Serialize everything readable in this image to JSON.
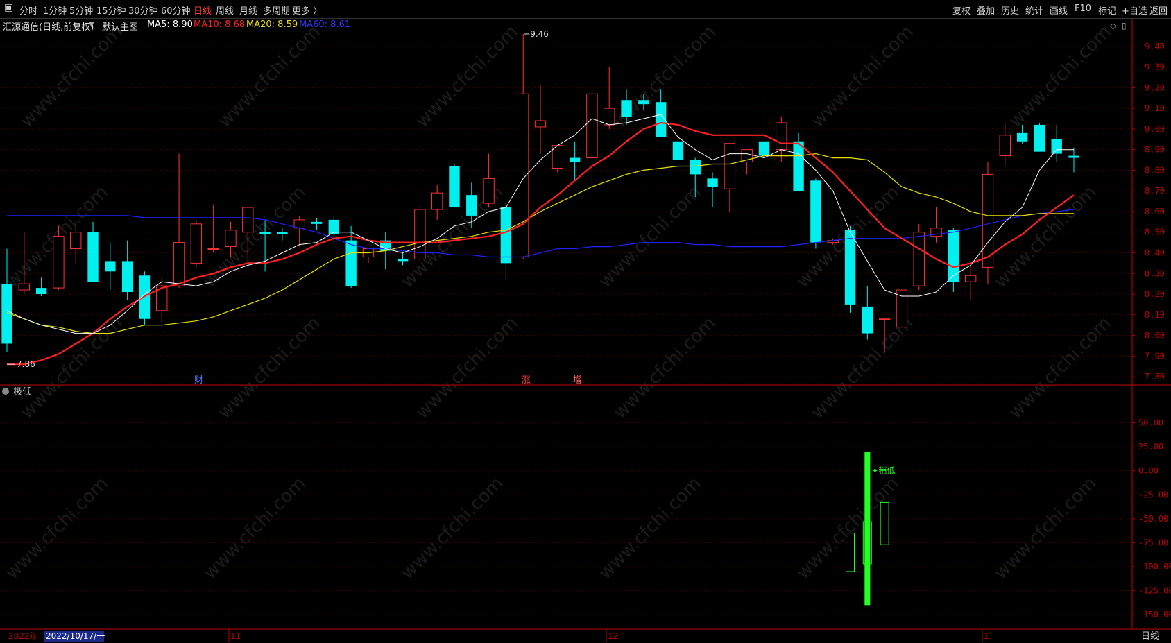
{
  "toolbar": {
    "left_items": [
      "分时",
      "1分钟",
      "5分钟",
      "15分钟",
      "30分钟",
      "60分钟",
      "日线",
      "周线",
      "月线",
      "多周期",
      "更多 〉"
    ],
    "active": "日线",
    "right_items": [
      "复权",
      "叠加",
      "历史",
      "统计",
      "画线",
      "F10",
      "标记",
      "+自选",
      "返回"
    ]
  },
  "info": {
    "title": "汇源通信(日线,前复权)",
    "main_label": "默认主图",
    "ma5": "MA5: 8.90",
    "ma10": "MA10: 8.68",
    "ma20": "MA20: 8.59",
    "ma60": "MA60: 8.61"
  },
  "colors": {
    "up": "#ff3333",
    "down": "#00f0f0",
    "ma5": "#ffffff",
    "ma10": "#ff2020",
    "ma20": "#e8e000",
    "ma60": "#2020ff",
    "axis": "#c00000",
    "indicator": "#22ff22"
  },
  "price_axis": {
    "ticks": [
      "9.40",
      "9.30",
      "9.20",
      "9.10",
      "9.00",
      "8.90",
      "8.80",
      "8.70",
      "8.60",
      "8.50",
      "8.40",
      "8.30",
      "8.20",
      "8.10",
      "8.00",
      "7.90",
      "7.80"
    ]
  },
  "high_label": "9.46",
  "low_label": "7.86",
  "event_markers": [
    "财",
    "涨",
    "增"
  ],
  "sub_panel": {
    "title": "极低",
    "ticks": [
      "50.00",
      "25.00",
      "0.00",
      "-25.00",
      "-50.00",
      "-75.00",
      "-100.00",
      "-125.00",
      "-150.00"
    ],
    "signal_label": "稍低"
  },
  "date_axis": {
    "year": "2022年",
    "cursor_date": "2022/10/17/一",
    "month_labels": [
      "11",
      "12",
      "1"
    ],
    "period_button": "日线"
  },
  "watermark": "www.cfchi.com",
  "chart_data": {
    "type": "candlestick",
    "ohlc": [
      [
        8.25,
        8.42,
        7.92,
        7.96
      ],
      [
        8.22,
        8.5,
        8.2,
        8.25
      ],
      [
        8.23,
        8.28,
        8.19,
        8.2
      ],
      [
        8.23,
        8.53,
        8.22,
        8.48
      ],
      [
        8.42,
        8.55,
        8.35,
        8.5
      ],
      [
        8.5,
        8.55,
        8.26,
        8.26
      ],
      [
        8.36,
        8.45,
        8.22,
        8.31
      ],
      [
        8.36,
        8.46,
        8.17,
        8.21
      ],
      [
        8.29,
        8.31,
        8.05,
        8.08
      ],
      [
        8.12,
        8.28,
        8.06,
        8.24
      ],
      [
        8.24,
        8.88,
        8.23,
        8.45
      ],
      [
        8.35,
        8.56,
        8.33,
        8.54
      ],
      [
        8.42,
        8.63,
        8.4,
        8.42
      ],
      [
        8.43,
        8.55,
        8.38,
        8.51
      ],
      [
        8.5,
        8.58,
        8.35,
        8.62
      ],
      [
        8.5,
        8.56,
        8.31,
        8.49
      ],
      [
        8.5,
        8.52,
        8.46,
        8.49
      ],
      [
        8.52,
        8.58,
        8.43,
        8.56
      ],
      [
        8.55,
        8.57,
        8.51,
        8.54
      ],
      [
        8.56,
        8.58,
        8.45,
        8.49
      ],
      [
        8.46,
        8.53,
        8.23,
        8.24
      ],
      [
        8.38,
        8.42,
        8.35,
        8.42
      ],
      [
        8.46,
        8.5,
        8.32,
        8.41
      ],
      [
        8.37,
        8.4,
        8.34,
        8.36
      ],
      [
        8.37,
        8.63,
        8.36,
        8.61
      ],
      [
        8.61,
        8.73,
        8.56,
        8.69
      ],
      [
        8.82,
        8.83,
        8.62,
        8.62
      ],
      [
        8.68,
        8.74,
        8.52,
        8.58
      ],
      [
        8.64,
        8.88,
        8.62,
        8.76
      ],
      [
        8.62,
        8.64,
        8.27,
        8.35
      ],
      [
        8.38,
        9.46,
        8.37,
        9.17
      ],
      [
        9.01,
        9.21,
        8.88,
        9.04
      ],
      [
        8.81,
        8.92,
        8.79,
        8.92
      ],
      [
        8.86,
        8.94,
        8.75,
        8.84
      ],
      [
        8.86,
        9.17,
        8.72,
        9.17
      ],
      [
        9.02,
        9.3,
        9.0,
        9.1
      ],
      [
        9.14,
        9.19,
        9.02,
        9.06
      ],
      [
        9.14,
        9.17,
        9.09,
        9.12
      ],
      [
        9.13,
        9.19,
        8.96,
        8.96
      ],
      [
        8.94,
        8.95,
        8.87,
        8.85
      ],
      [
        8.85,
        8.86,
        8.67,
        8.78
      ],
      [
        8.76,
        8.79,
        8.62,
        8.72
      ],
      [
        8.71,
        8.93,
        8.6,
        8.93
      ],
      [
        8.84,
        8.9,
        8.78,
        8.9
      ],
      [
        8.94,
        9.15,
        8.87,
        8.87
      ],
      [
        8.9,
        9.06,
        8.84,
        9.03
      ],
      [
        8.94,
        8.98,
        8.7,
        8.7
      ],
      [
        8.75,
        8.76,
        8.42,
        8.45
      ],
      [
        8.45,
        8.47,
        8.44,
        8.46
      ],
      [
        8.51,
        8.53,
        8.11,
        8.15
      ],
      [
        8.14,
        8.24,
        7.98,
        8.01
      ],
      [
        8.08,
        8.08,
        7.92,
        8.08
      ],
      [
        8.04,
        8.08,
        8.04,
        8.22
      ],
      [
        8.24,
        8.54,
        8.22,
        8.5
      ],
      [
        8.48,
        8.62,
        8.45,
        8.52
      ],
      [
        8.51,
        8.52,
        8.21,
        8.26
      ],
      [
        8.26,
        8.35,
        8.17,
        8.29
      ],
      [
        8.33,
        8.84,
        8.25,
        8.78
      ],
      [
        8.87,
        9.03,
        8.82,
        8.97
      ],
      [
        8.98,
        9.02,
        8.93,
        8.94
      ],
      [
        9.02,
        9.03,
        8.89,
        8.89
      ],
      [
        8.95,
        9.02,
        8.84,
        8.88
      ],
      [
        8.87,
        8.91,
        8.79,
        8.86
      ]
    ],
    "ma5": [
      8.12,
      8.08,
      8.05,
      8.03,
      8.01,
      8.01,
      8.05,
      8.12,
      8.2,
      8.26,
      8.25,
      8.24,
      8.26,
      8.31,
      8.34,
      8.36,
      8.4,
      8.44,
      8.45,
      8.5,
      8.5,
      8.46,
      8.42,
      8.4,
      8.43,
      8.47,
      8.53,
      8.55,
      8.6,
      8.62,
      8.76,
      8.85,
      8.92,
      8.97,
      9.05,
      9.02,
      9.03,
      9.05,
      9.07,
      8.96,
      8.9,
      8.85,
      8.88,
      8.88,
      8.86,
      8.9,
      8.88,
      8.8,
      8.7,
      8.5,
      8.36,
      8.22,
      8.19,
      8.19,
      8.21,
      8.29,
      8.34,
      8.45,
      8.55,
      8.62,
      8.8,
      8.9,
      8.9
    ],
    "ma10": [
      7.86,
      7.86,
      7.88,
      7.91,
      7.96,
      8.01,
      8.08,
      8.14,
      8.19,
      8.23,
      8.25,
      8.28,
      8.3,
      8.33,
      8.35,
      8.35,
      8.37,
      8.4,
      8.44,
      8.47,
      8.48,
      8.46,
      8.45,
      8.45,
      8.45,
      8.45,
      8.46,
      8.47,
      8.48,
      8.5,
      8.54,
      8.62,
      8.68,
      8.75,
      8.82,
      8.87,
      8.94,
      9.0,
      9.03,
      9.02,
      8.99,
      8.97,
      8.97,
      8.97,
      8.97,
      8.93,
      8.93,
      8.86,
      8.79,
      8.7,
      8.61,
      8.52,
      8.47,
      8.42,
      8.37,
      8.33,
      8.35,
      8.38,
      8.44,
      8.49,
      8.56,
      8.62,
      8.68
    ],
    "ma20": [
      8.11,
      8.08,
      8.05,
      8.04,
      8.02,
      8.01,
      8.01,
      8.03,
      8.05,
      8.05,
      8.06,
      8.07,
      8.09,
      8.12,
      8.15,
      8.18,
      8.22,
      8.27,
      8.32,
      8.37,
      8.4,
      8.4,
      8.41,
      8.43,
      8.45,
      8.46,
      8.47,
      8.48,
      8.5,
      8.51,
      8.55,
      8.6,
      8.64,
      8.68,
      8.72,
      8.75,
      8.78,
      8.8,
      8.81,
      8.82,
      8.82,
      8.83,
      8.83,
      8.85,
      8.87,
      8.87,
      8.87,
      8.88,
      8.86,
      8.86,
      8.85,
      8.79,
      8.72,
      8.69,
      8.67,
      8.64,
      8.6,
      8.58,
      8.58,
      8.58,
      8.59,
      8.59,
      8.59
    ],
    "ma60": [
      8.58,
      8.58,
      8.58,
      8.58,
      8.58,
      8.58,
      8.58,
      8.58,
      8.57,
      8.57,
      8.57,
      8.57,
      8.57,
      8.57,
      8.57,
      8.56,
      8.54,
      8.52,
      8.5,
      8.47,
      8.44,
      8.42,
      8.42,
      8.41,
      8.4,
      8.4,
      8.39,
      8.39,
      8.38,
      8.38,
      8.38,
      8.4,
      8.42,
      8.42,
      8.43,
      8.43,
      8.44,
      8.45,
      8.45,
      8.45,
      8.44,
      8.44,
      8.43,
      8.43,
      8.43,
      8.43,
      8.44,
      8.45,
      8.46,
      8.47,
      8.47,
      8.47,
      8.47,
      8.48,
      8.49,
      8.5,
      8.52,
      8.54,
      8.56,
      8.58,
      8.59,
      8.6,
      8.61
    ],
    "yrange": [
      7.76,
      9.47
    ],
    "indicator_bars": [
      {
        "index": 49,
        "open": -65,
        "close": -105,
        "filled": false
      },
      {
        "index": 50,
        "open": 20,
        "close": -140,
        "filled": true
      },
      {
        "index": 50,
        "open": -53,
        "close": -97,
        "filled": false
      },
      {
        "index": 51,
        "open": -33,
        "close": -77,
        "filled": false
      }
    ],
    "indicator_yrange": [
      -160,
      75
    ]
  }
}
